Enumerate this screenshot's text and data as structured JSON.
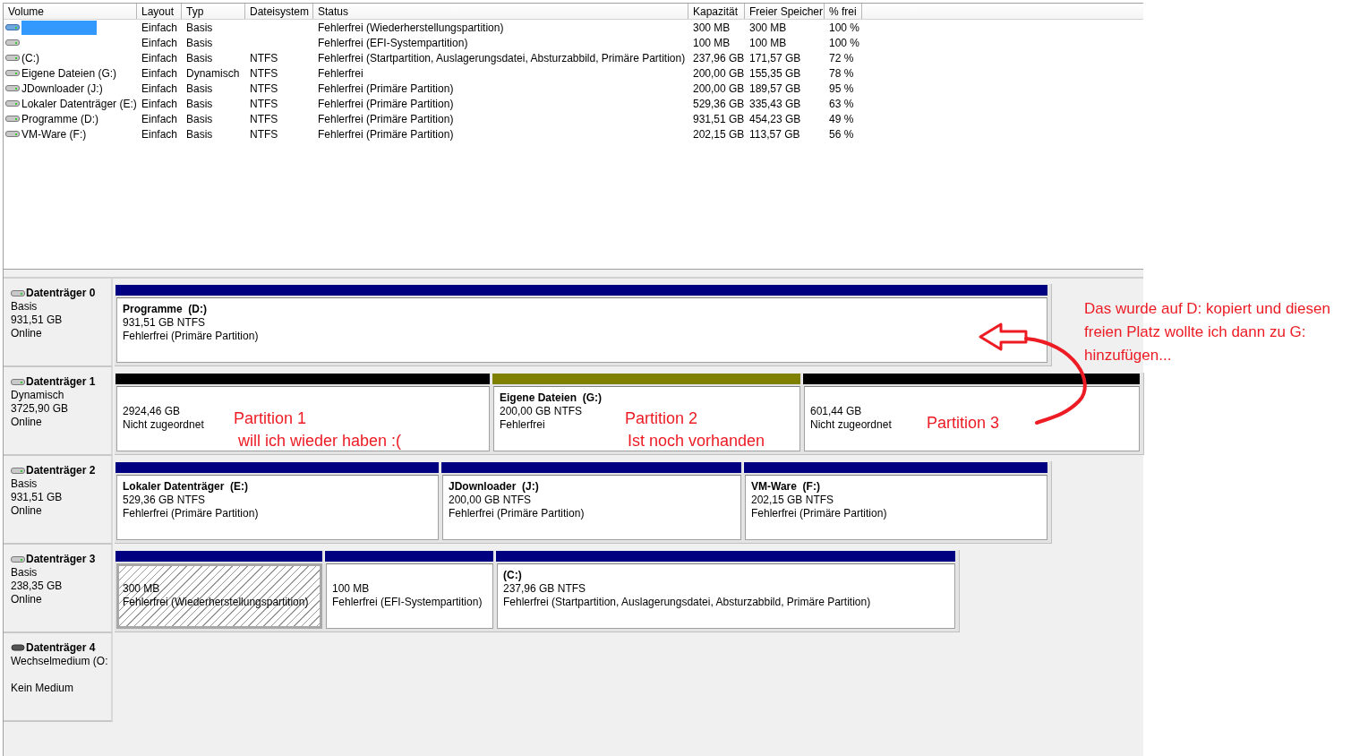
{
  "volume_list": {
    "columns": [
      "Volume",
      "Layout",
      "Typ",
      "Dateisystem",
      "Status",
      "Kapazität",
      "Freier Speicher",
      "% frei"
    ],
    "rows": [
      {
        "selected": true,
        "layout": "Einfach",
        "type": "Basis",
        "status": "Fehlerfrei (Wiederherstellungspartition)",
        "capacity": "300 MB",
        "free_space": "300 MB",
        "percent_free": "100 %"
      },
      {
        "selected": false,
        "layout": "Einfach",
        "type": "Basis",
        "status": "Fehlerfrei (EFI-Systempartition)",
        "capacity": "100 MB",
        "free_space": "100 MB",
        "percent_free": "100 %"
      },
      {
        "selected": false,
        "volume": "(C:)",
        "layout": "Einfach",
        "type": "Basis",
        "file_system": "NTFS",
        "status": "Fehlerfrei (Startpartition, Auslagerungsdatei, Absturzabbild, Primäre Partition)",
        "capacity": "237,96 GB",
        "free_space": "171,57 GB",
        "percent_free": "72 %"
      },
      {
        "selected": false,
        "volume": "Eigene Dateien (G:)",
        "layout": "Einfach",
        "type": "Dynamisch",
        "file_system": "NTFS",
        "status": "Fehlerfrei",
        "capacity": "200,00 GB",
        "free_space": "155,35 GB",
        "percent_free": "78 %"
      },
      {
        "selected": false,
        "volume": "JDownloader (J:)",
        "layout": "Einfach",
        "type": "Basis",
        "file_system": "NTFS",
        "status": "Fehlerfrei (Primäre Partition)",
        "capacity": "200,00 GB",
        "free_space": "189,57 GB",
        "percent_free": "95 %"
      },
      {
        "selected": false,
        "volume": "Lokaler Datenträger (E:)",
        "layout": "Einfach",
        "type": "Basis",
        "file_system": "NTFS",
        "status": "Fehlerfrei (Primäre Partition)",
        "capacity": "529,36 GB",
        "free_space": "335,43 GB",
        "percent_free": "63 %"
      },
      {
        "selected": false,
        "volume": "Programme (D:)",
        "layout": "Einfach",
        "type": "Basis",
        "file_system": "NTFS",
        "status": "Fehlerfrei (Primäre Partition)",
        "capacity": "931,51 GB",
        "free_space": "454,23 GB",
        "percent_free": "49 %"
      },
      {
        "selected": false,
        "volume": "VM-Ware (F:)",
        "layout": "Einfach",
        "type": "Basis",
        "file_system": "NTFS",
        "status": "Fehlerfrei (Primäre Partition)",
        "capacity": "202,15 GB",
        "free_space": "113,57 GB",
        "percent_free": "56 %"
      }
    ]
  },
  "disks": [
    {
      "kind": "fixed",
      "name": "Datenträger 0",
      "type": "Basis",
      "size": "931,51 GB",
      "state": "Online",
      "partitions": [
        {
          "kind": "primary",
          "selected": false,
          "name": "Programme  (D:)",
          "size": "931,51 GB NTFS",
          "status": "Fehlerfrei (Primäre Partition)"
        }
      ]
    },
    {
      "kind": "fixed",
      "name": "Datenträger 1",
      "type": "Dynamisch",
      "size": "3725,90 GB",
      "state": "Online",
      "partitions": [
        {
          "kind": "unallocated",
          "selected": false,
          "size": "2924,46 GB",
          "status": "Nicht zugeordnet"
        },
        {
          "kind": "simple",
          "selected": false,
          "name": "Eigene Dateien  (G:)",
          "size": "200,00 GB NTFS",
          "status": "Fehlerfrei"
        },
        {
          "kind": "unallocated",
          "selected": false,
          "size": "601,44 GB",
          "status": "Nicht zugeordnet"
        }
      ]
    },
    {
      "kind": "fixed",
      "name": "Datenträger 2",
      "type": "Basis",
      "size": "931,51 GB",
      "state": "Online",
      "partitions": [
        {
          "kind": "primary",
          "selected": false,
          "name": "Lokaler Datenträger  (E:)",
          "size": "529,36 GB NTFS",
          "status": "Fehlerfrei (Primäre Partition)"
        },
        {
          "kind": "primary",
          "selected": false,
          "name": "JDownloader  (J:)",
          "size": "200,00 GB NTFS",
          "status": "Fehlerfrei (Primäre Partition)"
        },
        {
          "kind": "primary",
          "selected": false,
          "name": "VM-Ware  (F:)",
          "size": "202,15 GB NTFS",
          "status": "Fehlerfrei (Primäre Partition)"
        }
      ]
    },
    {
      "kind": "fixed",
      "name": "Datenträger 3",
      "type": "Basis",
      "size": "238,35 GB",
      "state": "Online",
      "partitions": [
        {
          "kind": "primary",
          "selected": true,
          "size": "300 MB",
          "status": "Fehlerfrei (Wiederherstellungspartition)"
        },
        {
          "kind": "primary",
          "selected": false,
          "size": "100 MB",
          "status": "Fehlerfrei (EFI-Systempartition)"
        },
        {
          "kind": "primary",
          "selected": false,
          "name": "(C:)",
          "size": "237,96 GB NTFS",
          "status": "Fehlerfrei (Startpartition, Auslagerungsdatei, Absturzabbild, Primäre Partition)"
        }
      ]
    },
    {
      "kind": "removable",
      "name": "Datenträger 4",
      "type": "Wechselmedium (O:",
      "state": "Kein Medium"
    }
  ],
  "annotations": [
    "Partition 1",
    "will ich wieder haben :(",
    "Partition 2",
    "Ist noch vorhanden",
    "Partition 3",
    "Das wurde auf D: kopiert und diesen freien Platz wollte ich dann zu G: hinzufügen..."
  ]
}
